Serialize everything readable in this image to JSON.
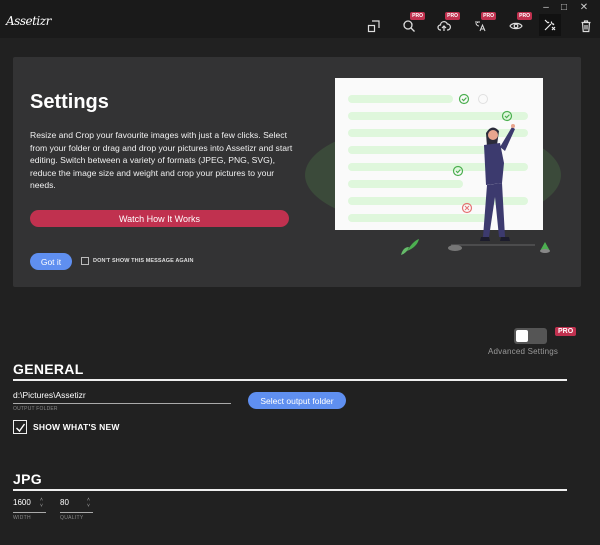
{
  "app": {
    "logo_text": "Assetizr"
  },
  "window_controls": {
    "minimize": "–",
    "maximize": "□",
    "close": "✕"
  },
  "toolbar": {
    "pro_label": "PRO",
    "tools": [
      {
        "name": "resize-tool",
        "icon": "resize-icon",
        "pro": false
      },
      {
        "name": "search-tool",
        "icon": "search-icon",
        "pro": true
      },
      {
        "name": "cloud-upload-tool",
        "icon": "cloud-upload-icon",
        "pro": true
      },
      {
        "name": "translate-tool",
        "icon": "translate-icon",
        "pro": true
      },
      {
        "name": "preview-tool",
        "icon": "eye-icon",
        "pro": true
      },
      {
        "name": "settings-tool",
        "icon": "tools-icon",
        "pro": false,
        "active": true
      },
      {
        "name": "delete-tool",
        "icon": "trash-icon",
        "pro": false
      }
    ]
  },
  "banner": {
    "title": "Settings",
    "description": "Resize and Crop your favourite images with just a few clicks. Select from your folder or drag and drop your pictures into Assetizr and start editing. Switch between a variety of formats (JPEG, PNG, SVG), reduce the image size and weight and crop your pictures to your needs.",
    "watch_button": "Watch How It Works",
    "gotit_button": "Got it",
    "dont_show_label": "DON'T SHOW THIS MESSAGE AGAIN"
  },
  "advanced": {
    "pro_badge": "PRO",
    "label": "Advanced Settings",
    "enabled": false
  },
  "general": {
    "title": "GENERAL",
    "output_folder_value": "d:\\Pictures\\Assetizr",
    "output_folder_caption": "OUTPUT FOLDER",
    "select_button": "Select output folder",
    "whats_new_label": "SHOW WHAT'S NEW",
    "whats_new_checked": true
  },
  "jpg": {
    "title": "JPG",
    "width_value": "1600",
    "width_caption": "WIDTH",
    "quality_value": "80",
    "quality_caption": "QUALITY"
  },
  "colors": {
    "accent_pink": "#c0314f",
    "accent_blue": "#5f8ff0",
    "background": "#212121",
    "banner": "#333334"
  }
}
